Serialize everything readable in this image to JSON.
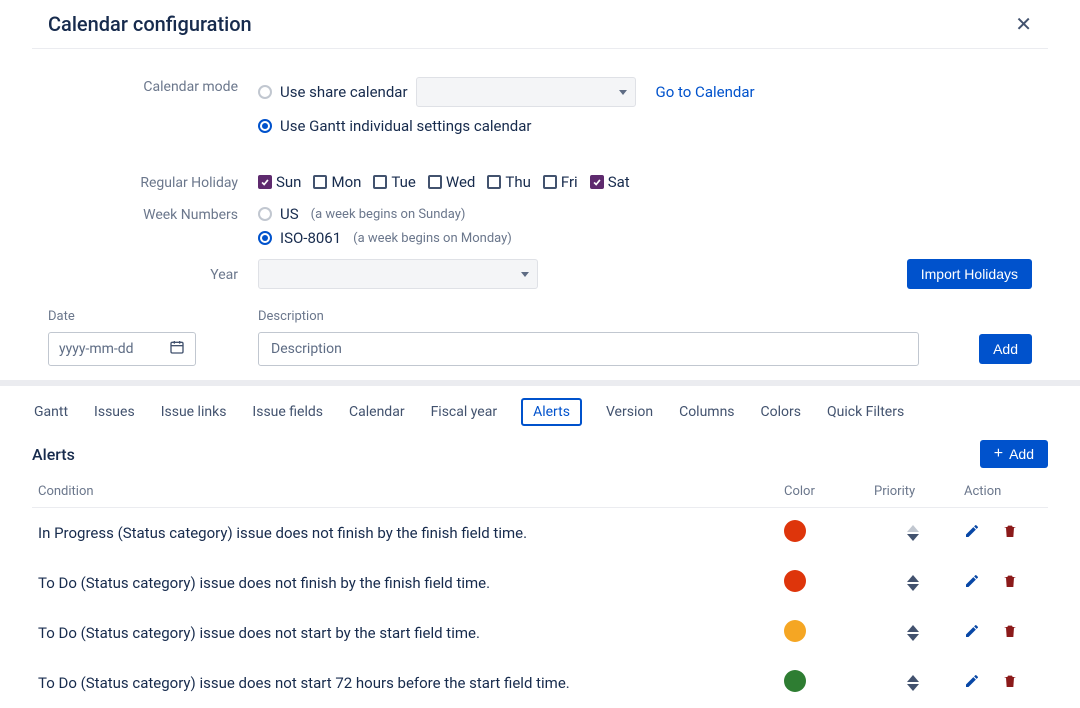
{
  "header": {
    "title": "Calendar configuration"
  },
  "calendarMode": {
    "label": "Calendar mode",
    "opt_share": "Use share calendar",
    "link": "Go to Calendar",
    "opt_gantt": "Use Gantt individual settings calendar"
  },
  "regularHoliday": {
    "label": "Regular Holiday",
    "days": [
      {
        "label": "Sun",
        "checked": true
      },
      {
        "label": "Mon",
        "checked": false
      },
      {
        "label": "Tue",
        "checked": false
      },
      {
        "label": "Wed",
        "checked": false
      },
      {
        "label": "Thu",
        "checked": false
      },
      {
        "label": "Fri",
        "checked": false
      },
      {
        "label": "Sat",
        "checked": true
      }
    ]
  },
  "weekNumbers": {
    "label": "Week Numbers",
    "opt_us": "US",
    "hint_us": "(a week begins on Sunday)",
    "opt_iso": "ISO-8061",
    "hint_iso": "(a week begins on Monday)"
  },
  "year": {
    "label": "Year",
    "import_btn": "Import Holidays"
  },
  "dateDesc": {
    "date_h": "Date",
    "desc_h": "Description",
    "date_ph": "yyyy-mm-dd",
    "desc_ph": "Description",
    "add_btn": "Add"
  },
  "tabs": [
    "Gantt",
    "Issues",
    "Issue links",
    "Issue fields",
    "Calendar",
    "Fiscal year",
    "Alerts",
    "Version",
    "Columns",
    "Colors",
    "Quick Filters"
  ],
  "alerts": {
    "title": "Alerts",
    "add_btn": "Add",
    "columns": {
      "cond": "Condition",
      "color": "Color",
      "prio": "Priority",
      "action": "Action"
    },
    "rows": [
      {
        "cond": "In Progress (Status category) issue does not finish by the finish field time.",
        "color": "#de350b",
        "up_dim": true
      },
      {
        "cond": "To Do (Status category) issue does not finish by the finish field time.",
        "color": "#de350b",
        "up_dim": false
      },
      {
        "cond": "To Do (Status category) issue does not start by the start field time.",
        "color": "#f5a623",
        "up_dim": false
      },
      {
        "cond": "To Do (Status category) issue does not start 72 hours before the start field time.",
        "color": "#2e7d32",
        "up_dim": false
      }
    ]
  },
  "colors": {
    "edit_icon": "#0747a6",
    "delete_icon": "#8b1a1a"
  }
}
